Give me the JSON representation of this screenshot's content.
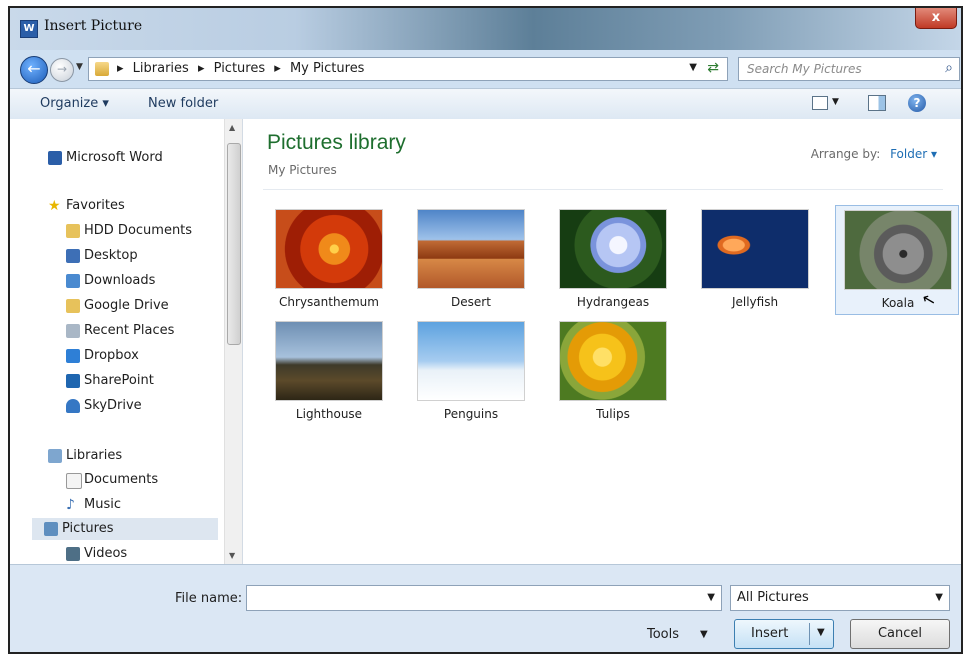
{
  "window": {
    "title": "Insert Picture",
    "close_glyph": "x"
  },
  "address": {
    "crumbs": [
      "Libraries",
      "Pictures",
      "My Pictures"
    ],
    "search_placeholder": "Search My Pictures"
  },
  "toolbar": {
    "organize": "Organize ▾",
    "new_folder": "New folder"
  },
  "nav": {
    "top": "Microsoft Word",
    "favorites_label": "Favorites",
    "favorites": [
      "HDD Documents",
      "Desktop",
      "Downloads",
      "Google Drive",
      "Recent Places",
      "Dropbox",
      "SharePoint",
      "SkyDrive"
    ],
    "libraries_label": "Libraries",
    "libraries": [
      "Documents",
      "Music",
      "Pictures",
      "Videos"
    ],
    "selected": "Pictures"
  },
  "content": {
    "title": "Pictures library",
    "subtitle": "My Pictures",
    "arrange_label": "Arrange by:",
    "arrange_value": "Folder ▾",
    "items": [
      "Chrysanthemum",
      "Desert",
      "Hydrangeas",
      "Jellyfish",
      "Koala",
      "Lighthouse",
      "Penguins",
      "Tulips"
    ],
    "selected_item": "Koala"
  },
  "bottom": {
    "file_name_label": "File name:",
    "file_name_value": "",
    "filter_value": "All Pictures",
    "tools_label": "Tools",
    "insert_label": "Insert",
    "cancel_label": "Cancel"
  },
  "colors": {
    "accent": "#1e6e2e",
    "selection": "#e8f1fb",
    "link": "#1e6eb4"
  }
}
